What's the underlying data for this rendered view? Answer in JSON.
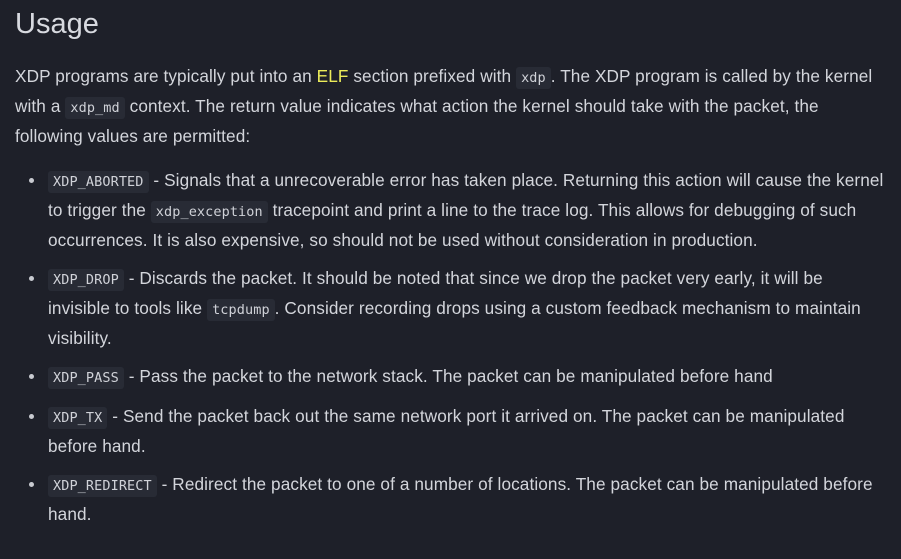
{
  "heading": "Usage",
  "intro": {
    "t1": "XDP programs are typically put into an ",
    "elf": "ELF",
    "t2": " section prefixed with ",
    "c1": "xdp",
    "t3": ". The XDP program is called by the kernel with a ",
    "c2": "xdp_md",
    "t4": " context. The return value indicates what action the kernel should take with the packet, the following values are permitted:"
  },
  "colors": {
    "background": "#1e2029",
    "text": "#d3d5db",
    "highlight": "#ecec5a",
    "code_bg": "#282b35"
  },
  "items": [
    {
      "code": "XDP_ABORTED",
      "t1": " - Signals that a unrecoverable error has taken place. Returning this action will cause the kernel to trigger the ",
      "c2": "xdp_exception",
      "t2": " tracepoint and print a line to the trace log. This allows for debugging of such occurrences. It is also expensive, so should not be used without consideration in production."
    },
    {
      "code": "XDP_DROP",
      "t1": " - Discards the packet. It should be noted that since we drop the packet very early, it will be invisible to tools like ",
      "c2": "tcpdump",
      "t2": ". Consider recording drops using a custom feedback mechanism to maintain visibility."
    },
    {
      "code": "XDP_PASS",
      "t1": " - Pass the packet to the network stack. The packet can be manipulated before hand"
    },
    {
      "code": "XDP_TX",
      "t1": " - Send the packet back out the same network port it arrived on. The packet can be manipulated before hand."
    },
    {
      "code": "XDP_REDIRECT",
      "t1": " - Redirect the packet to one of a number of locations. The packet can be manipulated before hand."
    }
  ]
}
